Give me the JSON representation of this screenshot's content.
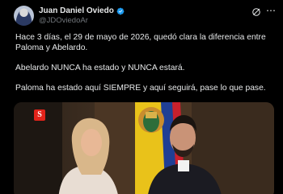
{
  "author": {
    "name": "Juan Daniel Oviedo",
    "handle": "@JDOviedoAr"
  },
  "icons": {
    "verified": "verified-badge-icon",
    "grok": "grok-icon",
    "more": "more-options-icon"
  },
  "more_label": "⋯",
  "post": {
    "paragraph1": "Hace 3 días, el 29 de mayo de 2026, quedó clara la diferencia entre Paloma y Abelardo.",
    "paragraph2": "Abelardo NUNCA ha estado y NUNCA estará.",
    "paragraph3": "Paloma ha estado aquí SIEMPRE y aquí seguirá, pase lo que pase."
  },
  "media": {
    "badge": "S"
  },
  "colors": {
    "background": "#000000",
    "text": "#e7e9ea",
    "secondary": "#71767b",
    "verified": "#1d9bf0",
    "badge": "#e2231a"
  }
}
